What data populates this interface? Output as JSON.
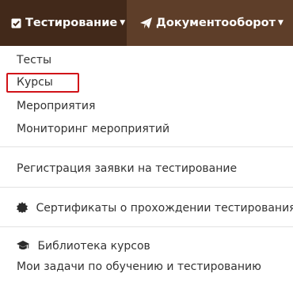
{
  "navbar": {
    "tabs": [
      {
        "label": "Тестирование",
        "icon": "check-square-icon",
        "active": true
      },
      {
        "label": "Документооборот",
        "icon": "paper-plane-icon",
        "active": false
      }
    ]
  },
  "dropdown": {
    "groups": [
      {
        "items": [
          {
            "label": "Тесты"
          },
          {
            "label": "Курсы",
            "highlighted": true
          },
          {
            "label": "Мероприятия"
          },
          {
            "label": "Мониторинг мероприятий"
          }
        ]
      },
      {
        "items": [
          {
            "label": "Регистрация заявки на тестирование"
          }
        ]
      },
      {
        "items": [
          {
            "label": "Сертификаты о прохождении тестирования",
            "icon": "certificate-icon"
          }
        ]
      },
      {
        "items": [
          {
            "label": "Библиотека курсов",
            "icon": "graduation-cap-icon"
          },
          {
            "label": "Мои задачи по обучению и тестированию"
          }
        ]
      }
    ]
  },
  "colors": {
    "navbar_bg": "#5e3e29",
    "active_tab_bg": "#42291a",
    "highlight_border": "#d11218",
    "text": "#333333"
  }
}
